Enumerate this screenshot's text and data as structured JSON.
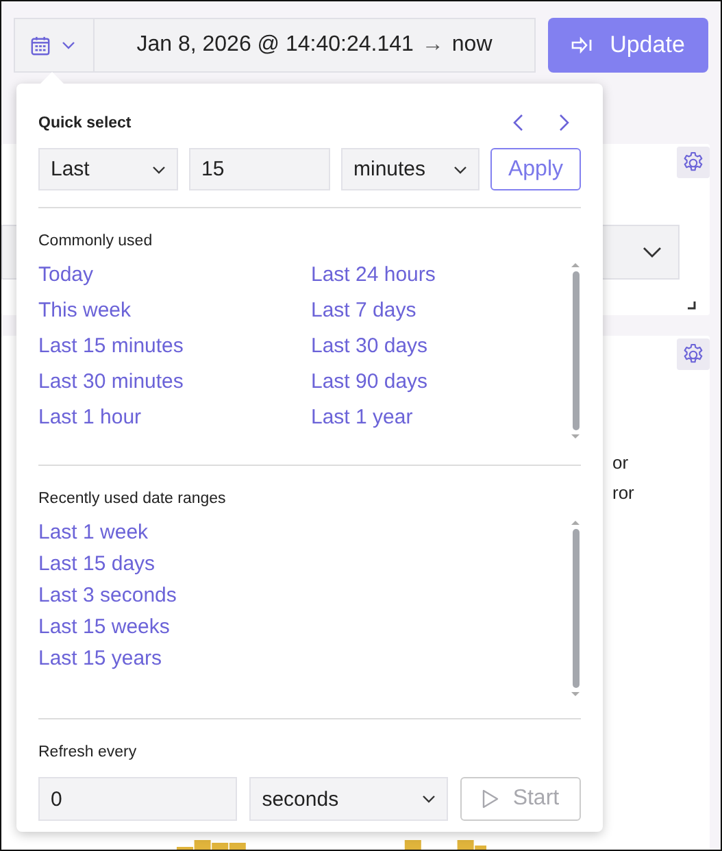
{
  "date_picker": {
    "start": "Jan 8, 2026 @ 14:40:24.141",
    "arrow": "→",
    "end": "now"
  },
  "update_button": {
    "label": "Update"
  },
  "quick_select": {
    "title": "Quick select",
    "direction": "Last",
    "amount": "15",
    "unit": "minutes",
    "apply": "Apply"
  },
  "commonly_used": {
    "title": "Commonly used",
    "items": [
      "Today",
      "This week",
      "Last 15 minutes",
      "Last 30 minutes",
      "Last 1 hour",
      "Last 24 hours",
      "Last 7 days",
      "Last 30 days",
      "Last 90 days",
      "Last 1 year"
    ]
  },
  "recently_used": {
    "title": "Recently used date ranges",
    "items": [
      "Last 1 week",
      "Last 15 days",
      "Last 3 seconds",
      "Last 15 weeks",
      "Last 15 years"
    ]
  },
  "refresh": {
    "title": "Refresh every",
    "interval": "0",
    "unit": "seconds",
    "start": "Start",
    "disabled": true
  },
  "background_panel": {
    "texts": [
      "or",
      "ror"
    ]
  }
}
